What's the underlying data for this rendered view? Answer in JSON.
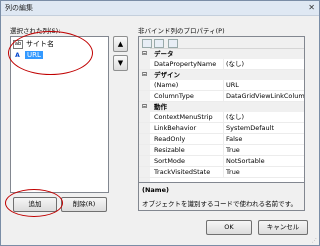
{
  "window": {
    "title": "列の編集",
    "close_glyph": "✕"
  },
  "left": {
    "label": "選択された列(S):",
    "items": [
      {
        "icon": "ab",
        "label": "サイト名",
        "selected": false
      },
      {
        "icon": "A",
        "label": "URL",
        "selected": true
      }
    ],
    "move_up": "▲",
    "move_down": "▼",
    "add_label": "追加",
    "remove_label": "削除(R)"
  },
  "right": {
    "label": "非バインド列のプロパティ(P)",
    "categories": [
      {
        "toggle": "⊟",
        "name": "データ",
        "rows": [
          {
            "name": "DataPropertyName",
            "value": "(なし)"
          }
        ]
      },
      {
        "toggle": "⊟",
        "name": "デザイン",
        "rows": [
          {
            "name": "(Name)",
            "value": "URL"
          },
          {
            "name": "ColumnType",
            "value": "DataGridViewLinkColumn"
          }
        ]
      },
      {
        "toggle": "⊟",
        "name": "動作",
        "rows": [
          {
            "name": "ContextMenuStrip",
            "value": "(なし)"
          },
          {
            "name": "LinkBehavior",
            "value": "SystemDefault"
          },
          {
            "name": "ReadOnly",
            "value": "False"
          },
          {
            "name": "Resizable",
            "value": "True"
          },
          {
            "name": "SortMode",
            "value": "NotSortable"
          },
          {
            "name": "TrackVisitedState",
            "value": "True"
          }
        ]
      }
    ],
    "description_title": "(Name)",
    "description_text": "オブジェクトを識別するコードで使われる名前です。"
  },
  "footer": {
    "ok_label": "OK",
    "cancel_label": "キャンセル"
  },
  "annotation_color": "#c00000"
}
